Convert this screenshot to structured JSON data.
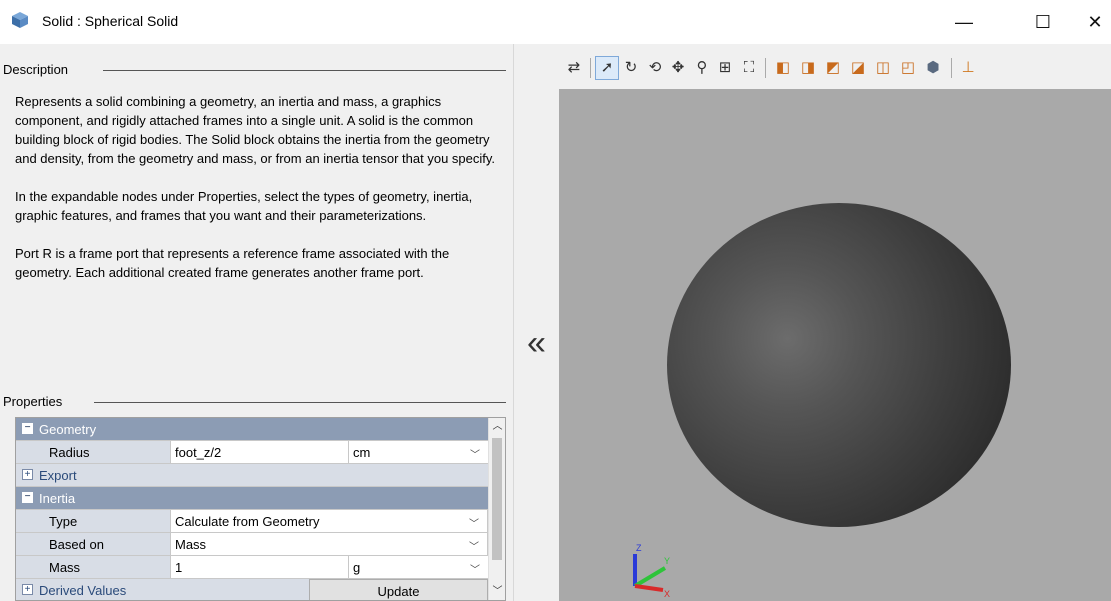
{
  "window": {
    "title": "Solid : Spherical Solid",
    "minimize": "—",
    "maximize": "☐",
    "close": "✕"
  },
  "description": {
    "header": "Description",
    "paragraphs": [
      "Represents a solid combining a geometry, an inertia and mass, a graphics component, and rigidly attached frames into a single unit. A solid is the common building block of rigid bodies. The Solid block obtains the inertia from the geometry and density, from the geometry and mass, or from an inertia tensor that you specify.",
      "In the expandable nodes under Properties, select the types of geometry, inertia, graphic features, and frames that you want and their parameterizations.",
      "Port R is a frame port that represents a reference frame associated with the geometry. Each additional created frame generates another frame port."
    ]
  },
  "properties": {
    "header": "Properties",
    "geometry": {
      "label": "Geometry",
      "toggle": "⊟",
      "radius": {
        "name": "Radius",
        "value": "foot_z/2",
        "unit": "cm"
      },
      "export": {
        "label": "Export",
        "toggle": "⊞"
      }
    },
    "inertia": {
      "label": "Inertia",
      "toggle": "⊟",
      "type": {
        "name": "Type",
        "value": "Calculate from Geometry"
      },
      "based_on": {
        "name": "Based on",
        "value": "Mass"
      },
      "mass": {
        "name": "Mass",
        "value": "1",
        "unit": "g"
      },
      "derived": {
        "label": "Derived Values",
        "toggle": "⊞",
        "button": "Update"
      }
    }
  },
  "panel": {
    "collapse_glyph": "«"
  },
  "colors": {
    "group_header": "#8c9cb4",
    "viewport_bg": "#a9a9a9",
    "sphere": "#3e3e3e"
  },
  "triad": {
    "x": "X",
    "y": "Y",
    "z": "Z"
  }
}
